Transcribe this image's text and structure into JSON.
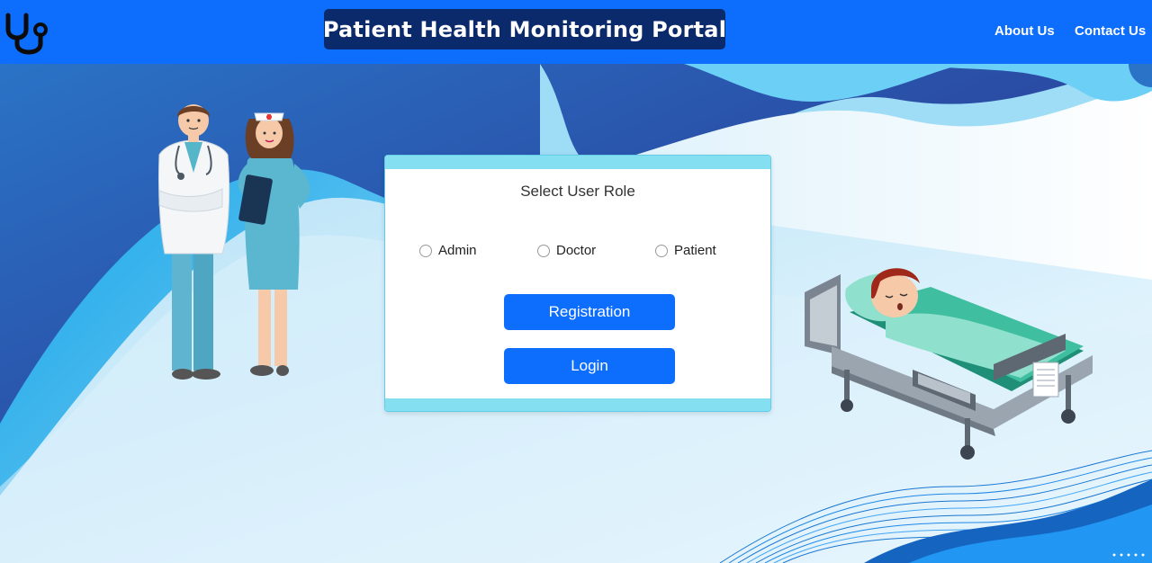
{
  "header": {
    "title": "Patient Health Monitoring Portal",
    "logo_icon": "stethoscope-icon",
    "nav": [
      {
        "label": "About Us"
      },
      {
        "label": "Contact Us"
      }
    ]
  },
  "role_card": {
    "heading": "Select User Role",
    "options": [
      {
        "label": "Admin",
        "checked": false
      },
      {
        "label": "Doctor",
        "checked": false
      },
      {
        "label": "Patient",
        "checked": false
      }
    ],
    "buttons": {
      "registration": "Registration",
      "login": "Login"
    }
  },
  "illustrations": {
    "left": "doctor-and-nurse-illustration",
    "right": "patient-in-hospital-bed-illustration"
  },
  "colors": {
    "header": "#0d6efd",
    "title_box": "#0b2a6b",
    "button": "#0d6efd",
    "card_bar": "#84dff0"
  }
}
